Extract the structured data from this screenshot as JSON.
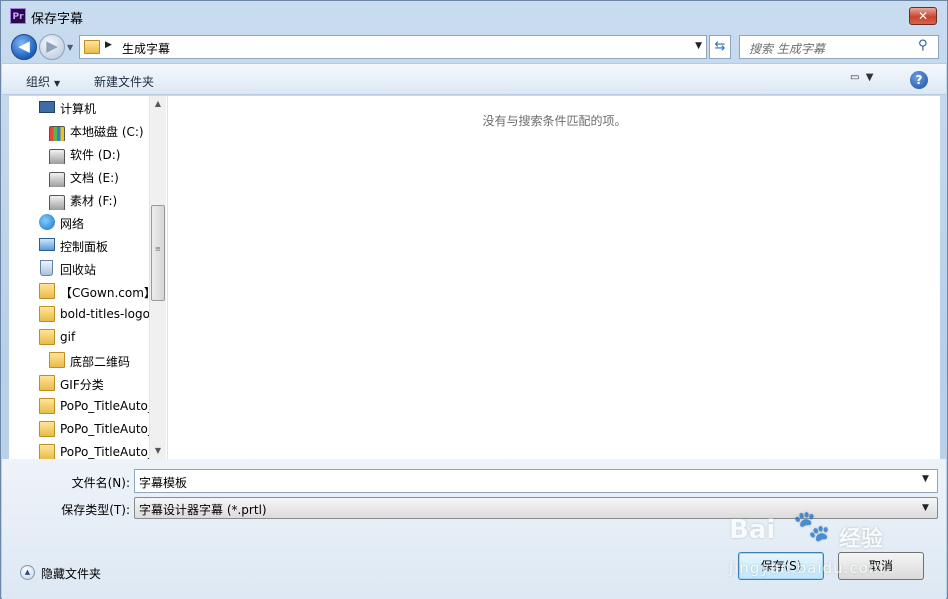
{
  "window": {
    "title": "保存字幕",
    "app_icon_text": "Pr",
    "close_glyph": "✕"
  },
  "nav": {
    "back_glyph": "◀",
    "forward_glyph": "▶",
    "address_path": "生成字幕",
    "search_placeholder": "搜索 生成字幕"
  },
  "toolbar": {
    "organize_label": "组织",
    "new_folder_label": "新建文件夹"
  },
  "sidebar": {
    "items": [
      {
        "label": "计算机",
        "icon": "computer-icon"
      },
      {
        "label": "本地磁盘 (C:)",
        "icon": "windows-drive-icon"
      },
      {
        "label": "软件 (D:)",
        "icon": "drive-icon"
      },
      {
        "label": "文档 (E:)",
        "icon": "drive-icon"
      },
      {
        "label": "素材 (F:)",
        "icon": "drive-icon"
      },
      {
        "label": "网络",
        "icon": "network-icon"
      },
      {
        "label": "控制面板",
        "icon": "control-panel-icon"
      },
      {
        "label": "回收站",
        "icon": "recycle-bin-icon"
      },
      {
        "label": "【CGown.com】",
        "icon": "folder-icon"
      },
      {
        "label": "bold-titles-logo",
        "icon": "folder-icon"
      },
      {
        "label": "gif",
        "icon": "folder-icon"
      },
      {
        "label": "底部二维码",
        "icon": "folder-icon"
      },
      {
        "label": "GIF分类",
        "icon": "folder-icon"
      },
      {
        "label": "PoPo_TitleAuto_",
        "icon": "folder-icon"
      },
      {
        "label": "PoPo_TitleAuto_",
        "icon": "folder-icon"
      },
      {
        "label": "PoPo_TitleAuto_",
        "icon": "folder-icon"
      }
    ]
  },
  "content": {
    "empty_message": "没有与搜索条件匹配的项。"
  },
  "form": {
    "filename_label": "文件名(N):",
    "filename_value": "字幕模板",
    "filetype_label": "保存类型(T):",
    "filetype_value": "字幕设计器字幕 (*.prtl)"
  },
  "footer": {
    "hide_folders_label": "隐藏文件夹",
    "save_label": "保存(S)",
    "cancel_label": "取消"
  },
  "watermark": {
    "brand_latin": "Bai",
    "brand_cn": "经验",
    "url": "jingyan.baidu.com"
  }
}
